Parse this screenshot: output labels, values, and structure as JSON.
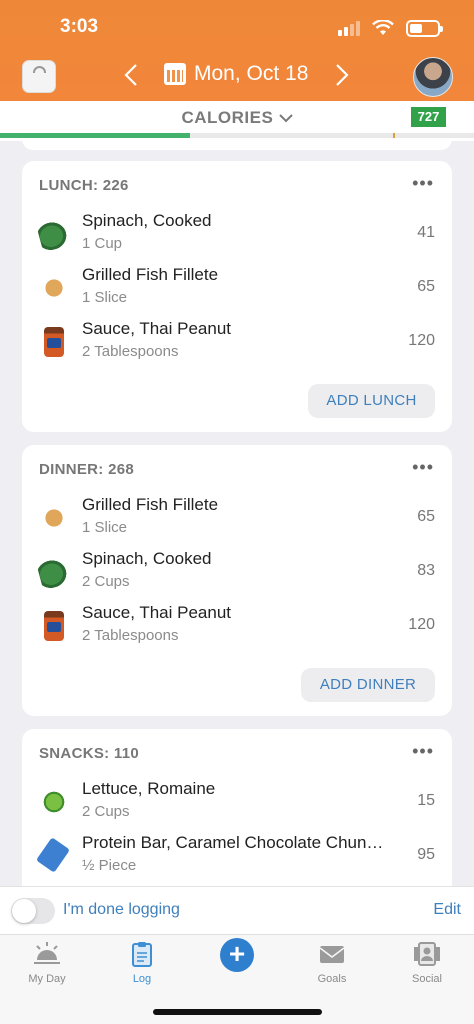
{
  "status_bar": {
    "time": "3:03",
    "battery_level": 0.45
  },
  "header": {
    "date": "Mon, Oct 18",
    "prev_icon": "chevron-left-icon",
    "next_icon": "chevron-right-icon",
    "calendar_icon": "calendar-icon",
    "scale_icon": "scale-icon",
    "avatar_icon": "profile-avatar"
  },
  "calories": {
    "label": "CALORIES",
    "remaining": "727",
    "progress": 0.4
  },
  "lunch": {
    "title": "LUNCH: 226",
    "add_label": "ADD LUNCH",
    "items": [
      {
        "name": "Spinach, Cooked",
        "qty": "1 Cup",
        "cal": "41"
      },
      {
        "name": "Grilled Fish Fillete",
        "qty": "1 Slice",
        "cal": "65"
      },
      {
        "name": "Sauce, Thai Peanut",
        "qty": "2 Tablespoons",
        "cal": "120"
      }
    ]
  },
  "dinner": {
    "title": "DINNER: 268",
    "add_label": "ADD DINNER",
    "items": [
      {
        "name": "Grilled Fish Fillete",
        "qty": "1 Slice",
        "cal": "65"
      },
      {
        "name": "Spinach, Cooked",
        "qty": "2 Cups",
        "cal": "83"
      },
      {
        "name": "Sauce, Thai Peanut",
        "qty": "2 Tablespoons",
        "cal": "120"
      }
    ]
  },
  "snacks": {
    "title": "SNACKS: 110",
    "items": [
      {
        "name": "Lettuce, Romaine",
        "qty": "2 Cups",
        "cal": "15"
      },
      {
        "name": "Protein Bar, Caramel Chocolate Chun…",
        "qty": "½ Piece",
        "cal": "95"
      }
    ]
  },
  "more_label": "•••",
  "done_logging": {
    "label": "I'm done logging",
    "edit_label": "Edit",
    "toggled": false
  },
  "tabs": [
    {
      "label": "My Day",
      "icon": "sunrise-icon"
    },
    {
      "label": "Log",
      "icon": "clipboard-icon"
    },
    {
      "label": "",
      "icon": "plus-icon"
    },
    {
      "label": "Goals",
      "icon": "envelope-icon"
    },
    {
      "label": "Social",
      "icon": "social-icon"
    }
  ],
  "colors": {
    "header": "#f2863a",
    "accent_blue": "#3f7fbc",
    "badge_green": "#32a24a"
  }
}
